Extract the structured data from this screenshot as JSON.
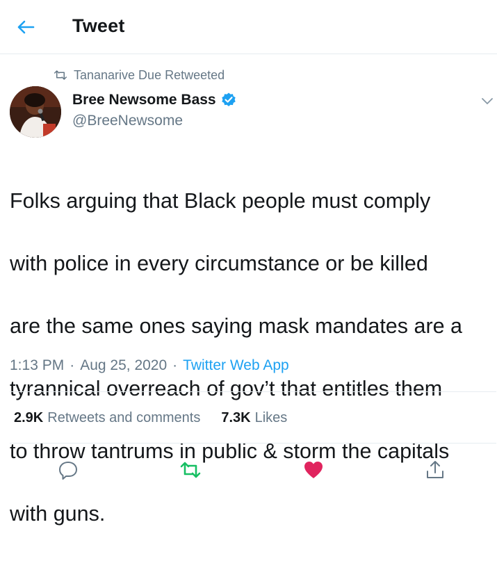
{
  "header": {
    "title": "Tweet"
  },
  "retweet_context": {
    "text": "Tananarive Due Retweeted"
  },
  "author": {
    "name": "Bree Newsome Bass",
    "handle": "@BreeNewsome"
  },
  "tweet": {
    "lines": [
      "Folks arguing that Black people must comply",
      "with police in every circumstance or be killed",
      "are the same ones saying mask mandates are a",
      "tyrannical overreach of gov’t that entitles them",
      "to throw tantrums in public & storm the capitals",
      "with guns."
    ],
    "time": "1:13 PM",
    "date": "Aug 25, 2020",
    "separator": "·",
    "source": "Twitter Web App"
  },
  "stats": {
    "retweets_count": "2.9K",
    "retweets_label": "Retweets and comments",
    "likes_count": "7.3K",
    "likes_label": "Likes"
  },
  "colors": {
    "accent": "#1da1f2",
    "retweeted_green": "#17bf63",
    "liked_pink": "#e0245e",
    "muted_text": "#657786"
  },
  "icons": {
    "back": "arrow-left-icon",
    "retweet_context": "retweet-icon",
    "verified": "verified-badge-icon",
    "more": "chevron-down-icon",
    "reply": "reply-icon",
    "retweet": "retweet-icon",
    "like": "heart-icon",
    "share": "share-icon"
  }
}
